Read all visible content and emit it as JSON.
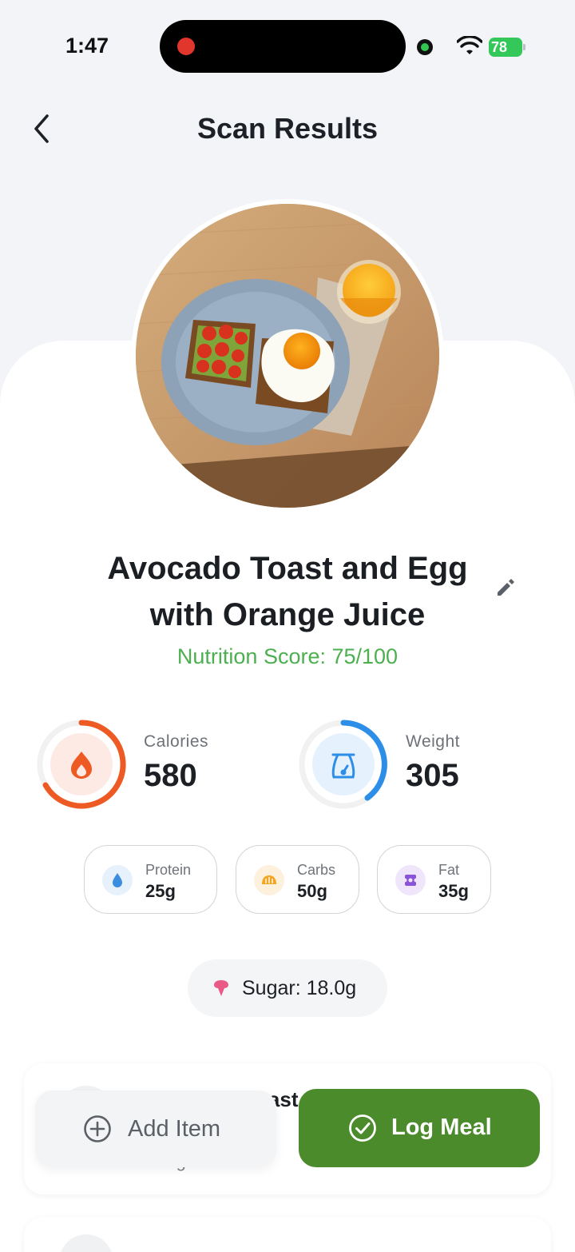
{
  "status_bar": {
    "time": "1:47",
    "battery": "78"
  },
  "header": {
    "title": "Scan Results",
    "back_icon": "chevron-left-icon"
  },
  "food": {
    "name": "Avocado Toast and Egg with Orange Juice",
    "nutrition_score": "Nutrition Score: 75/100"
  },
  "stats": [
    {
      "label": "Calories",
      "value": "580",
      "icon": "flame-icon",
      "color": "#ee5a24"
    },
    {
      "label": "Weight",
      "value": "305",
      "icon": "scale-icon",
      "color": "#2d8ee8"
    }
  ],
  "macros": [
    {
      "label": "Protein",
      "value": "25g",
      "icon": "drop-icon",
      "color": "#3b8de0"
    },
    {
      "label": "Carbs",
      "value": "50g",
      "icon": "bread-icon",
      "color": "#f3a623"
    },
    {
      "label": "Fat",
      "value": "35g",
      "icon": "fat-icon",
      "color": "#8a54d8"
    }
  ],
  "sugar": {
    "text": "Sugar: 18.0g",
    "icon": "sugar-icon",
    "color": "#e95a86"
  },
  "items": [
    {
      "name": "Avocado Toast",
      "weight": "75 g"
    },
    {
      "name": "",
      "weight": ""
    }
  ],
  "actions": {
    "add_item": "Add Item",
    "log_meal": "Log Meal",
    "log_meal_color": "#4b8b2b"
  }
}
